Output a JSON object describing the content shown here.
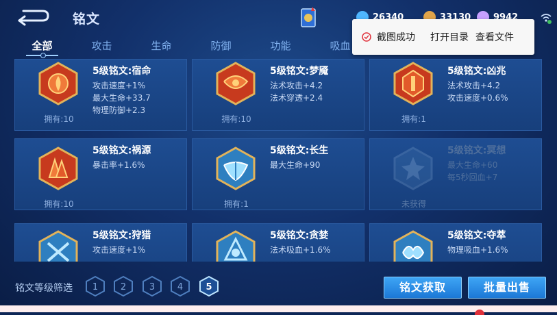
{
  "header": {
    "title": "铭文",
    "currencies": [
      {
        "name": "diamond",
        "value": "26340",
        "icon": "diamond-icon",
        "color": "#4fb6ff"
      },
      {
        "name": "gold",
        "value": "33130",
        "icon": "gold-coin-icon",
        "color": "#e0a44a"
      },
      {
        "name": "crystal",
        "value": "9942",
        "icon": "crystal-icon",
        "color": "#c6a0ff"
      }
    ]
  },
  "tabs": [
    {
      "label": "全部",
      "active": true
    },
    {
      "label": "攻击",
      "active": false
    },
    {
      "label": "生命",
      "active": false
    },
    {
      "label": "防御",
      "active": false
    },
    {
      "label": "功能",
      "active": false
    },
    {
      "label": "吸血",
      "active": false
    }
  ],
  "toast": {
    "status": "截图成功",
    "open_dir": "打开目录",
    "view_file": "查看文件"
  },
  "cards": [
    {
      "name": "5级铭文:宿命",
      "stats": [
        "攻击速度+1%",
        "最大生命+33.7",
        "物理防御+2.3"
      ],
      "owned": "拥有:10",
      "color": "#c73a1e",
      "locked": false
    },
    {
      "name": "5级铭文:梦魇",
      "stats": [
        "法术攻击+4.2",
        "法术穿透+2.4"
      ],
      "owned": "拥有:10",
      "color": "#c73a1e",
      "locked": false
    },
    {
      "name": "5级铭文:凶兆",
      "stats": [
        "法术攻击+4.2",
        "攻击速度+0.6%"
      ],
      "owned": "拥有:1",
      "color": "#c73a1e",
      "locked": false
    },
    {
      "name": "5级铭文:祸源",
      "stats": [
        "暴击率+1.6%"
      ],
      "owned": "拥有:10",
      "color": "#c73a1e",
      "locked": false
    },
    {
      "name": "5级铭文:长生",
      "stats": [
        "最大生命+90"
      ],
      "owned": "拥有:1",
      "color": "#3a8fc7",
      "locked": false
    },
    {
      "name": "5级铭文:冥想",
      "stats": [
        "最大生命+60",
        "每5秒回血+7"
      ],
      "owned": "未获得",
      "color": "#3a8fc7",
      "locked": true
    },
    {
      "name": "5级铭文:狩猎",
      "stats": [
        "攻击速度+1%"
      ],
      "owned": "",
      "color": "#3a8fc7",
      "locked": false
    },
    {
      "name": "5级铭文:贪婪",
      "stats": [
        "法术吸血+1.6%"
      ],
      "owned": "",
      "color": "#3a8fc7",
      "locked": false
    },
    {
      "name": "5级铭文:夺萃",
      "stats": [
        "物理吸血+1.6%"
      ],
      "owned": "",
      "color": "#3a8fc7",
      "locked": false
    }
  ],
  "bottom": {
    "filter_label": "铭文等级筛选",
    "levels": [
      "1",
      "2",
      "3",
      "4",
      "5"
    ],
    "selected_level": "5",
    "acquire_button": "铭文获取",
    "bulk_sell_button": "批量出售"
  }
}
